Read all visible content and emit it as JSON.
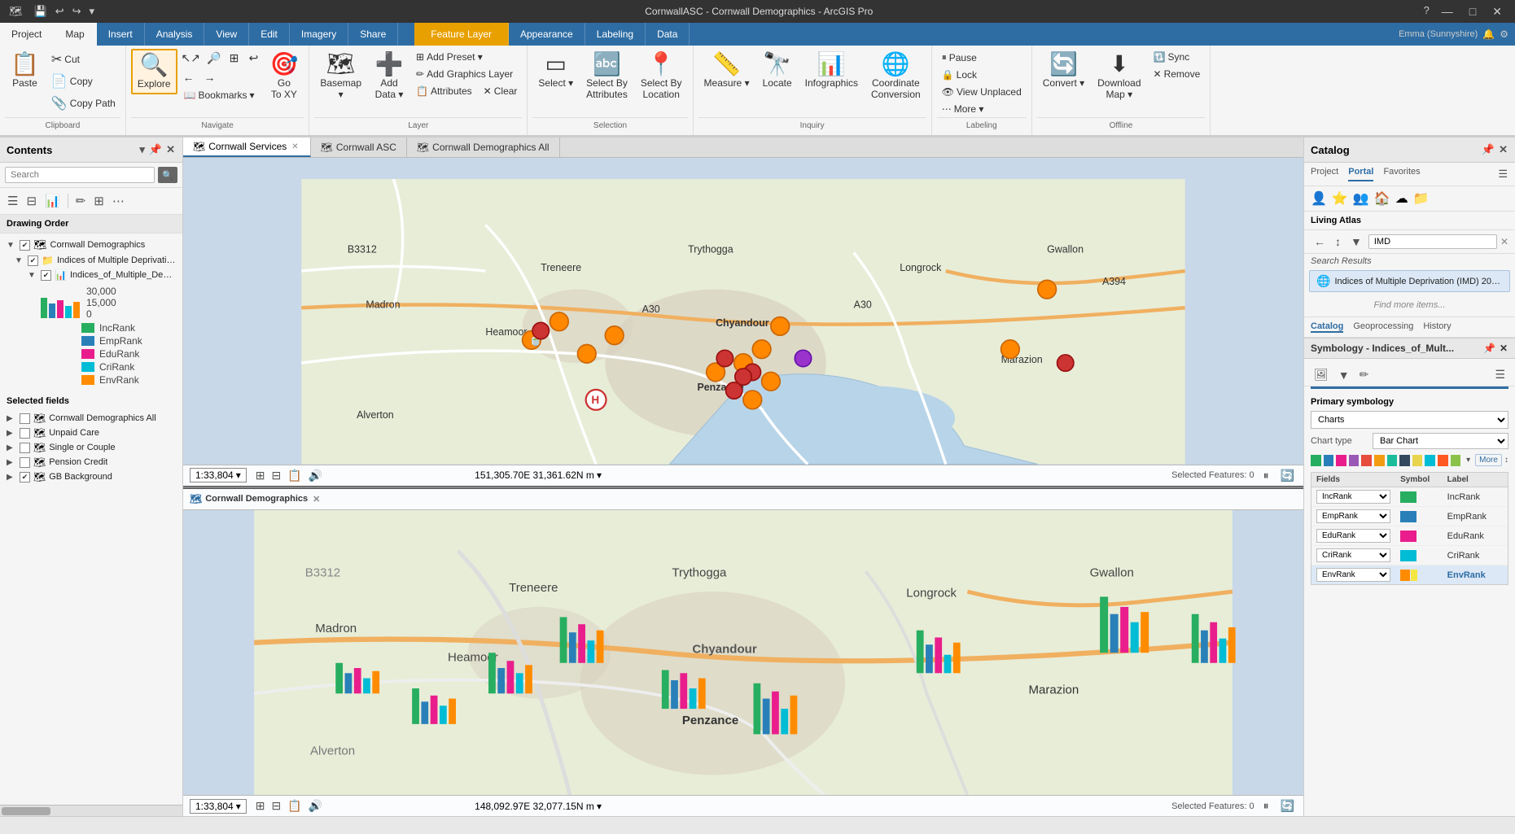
{
  "titlebar": {
    "title": "CornwallASC - Cornwall Demographics - ArcGIS Pro",
    "quicksave": "💾",
    "undo": "↩",
    "redo": "↪",
    "minimize": "—",
    "maximize": "□",
    "close": "✕",
    "help": "?"
  },
  "ribbon": {
    "tabs": [
      {
        "id": "project",
        "label": "Project",
        "active": false
      },
      {
        "id": "map",
        "label": "Map",
        "active": true
      },
      {
        "id": "insert",
        "label": "Insert",
        "active": false
      },
      {
        "id": "analysis",
        "label": "Analysis",
        "active": false
      },
      {
        "id": "view",
        "label": "View",
        "active": false
      },
      {
        "id": "edit",
        "label": "Edit",
        "active": false
      },
      {
        "id": "imagery",
        "label": "Imagery",
        "active": false
      },
      {
        "id": "share",
        "label": "Share",
        "active": false
      },
      {
        "id": "appearance",
        "label": "Appearance",
        "active": false
      },
      {
        "id": "labeling",
        "label": "Labeling",
        "active": false
      },
      {
        "id": "data",
        "label": "Data",
        "active": false
      }
    ],
    "feature_layer_tab": "Feature Layer",
    "groups": {
      "clipboard": {
        "label": "Clipboard",
        "buttons": [
          "Paste",
          "Cut",
          "Copy",
          "Copy Path"
        ]
      },
      "navigate": {
        "label": "Navigate",
        "explore": "Explore",
        "bookmarks": "Bookmarks",
        "goto_xy": "Go To XY"
      },
      "layer": {
        "label": "Layer",
        "basemap": "Basemap",
        "add_data": "Add Data",
        "add_preset": "Add Preset",
        "add_graphics": "Add Graphics Layer",
        "attributes": "Attributes",
        "clear": "Clear"
      },
      "selection": {
        "label": "Selection",
        "select": "Select",
        "select_by_attributes": "Select By Attributes",
        "select_by_location": "Select By Location"
      },
      "inquiry": {
        "label": "Inquiry",
        "measure": "Measure",
        "locate": "Locate",
        "infographics": "Infographics",
        "coordinate_conversion": "Coordinate Conversion"
      },
      "labeling": {
        "label": "Labeling",
        "pause": "Pause",
        "lock": "Lock",
        "view_unplaced": "View Unplaced",
        "more": "More"
      },
      "offline": {
        "label": "Offline",
        "convert": "Convert",
        "download_map": "Download Map",
        "sync": "Sync",
        "remove": "Remove"
      }
    }
  },
  "contents": {
    "title": "Contents",
    "search_placeholder": "Search",
    "drawing_order": "Drawing Order",
    "layers": [
      {
        "id": "cornwall-demographics",
        "name": "Cornwall Demographics",
        "level": 0,
        "checked": true,
        "expanded": true
      },
      {
        "id": "imd",
        "name": "Indices of Multiple Deprivation (I...",
        "level": 1,
        "checked": true,
        "expanded": true
      },
      {
        "id": "imd-sub",
        "name": "Indices_of_Multiple_Deprivation...",
        "level": 2,
        "checked": true,
        "expanded": true
      }
    ],
    "legend": [
      {
        "color": "#27ae60",
        "label": "IncRank"
      },
      {
        "color": "#2980b9",
        "label": "EmpRank"
      },
      {
        "color": "#e91e8c",
        "label": "EduRank"
      },
      {
        "color": "#00bcd4",
        "label": "CriRank"
      },
      {
        "color": "#ff8c00",
        "label": "EnvRank"
      }
    ],
    "scale_values": [
      "30,000",
      "15,000",
      "0"
    ],
    "selected_fields": "Selected fields",
    "other_layers": [
      {
        "name": "Cornwall Demographics All",
        "checked": false
      },
      {
        "name": "Unpaid Care",
        "checked": false
      },
      {
        "name": "Single or Couple",
        "checked": false
      },
      {
        "name": "Pension Credit",
        "checked": false
      },
      {
        "name": "GB Background",
        "checked": true
      }
    ]
  },
  "map_views": {
    "tabs": [
      {
        "id": "cornwall-services",
        "label": "Cornwall Services",
        "active": true,
        "closeable": true
      },
      {
        "id": "cornwall-asc",
        "label": "Cornwall ASC",
        "active": false,
        "closeable": false
      },
      {
        "id": "cornwall-demographics-all",
        "label": "Cornwall Demographics All",
        "active": false,
        "closeable": false
      }
    ],
    "top_map": {
      "title": "",
      "scale": "1:33,804",
      "coords": "151,305.70E 31,361.62N m",
      "selected_features": "Selected Features: 0",
      "map_labels": [
        "Madron",
        "Treneere",
        "Trythogga",
        "Heamoor",
        "Chyandour",
        "Longrock",
        "Gwallon",
        "Penzance",
        "Marazion"
      ],
      "road_labels": [
        "B3312",
        "A30",
        "A30",
        "A394"
      ]
    },
    "bottom_map": {
      "title": "Cornwall Demographics",
      "closeable": true,
      "scale": "1:33,804",
      "coords": "148,092.97E 32,077.15N m",
      "selected_features": "Selected Features: 0"
    }
  },
  "catalog": {
    "title": "Catalog",
    "tabs": [
      "Project",
      "Portal",
      "Favorites"
    ],
    "icons": [
      "👤",
      "⭐",
      "👥",
      "🏠",
      "🗃",
      "📁"
    ],
    "living_atlas": "Living Atlas",
    "search_value": "IMD",
    "search_results_label": "Search Results",
    "result_text": "Indices of Multiple Deprivation (IMD) 201...",
    "find_more": "Find more items...",
    "footer_tabs": [
      "Catalog",
      "Geoprocessing",
      "History"
    ]
  },
  "symbology": {
    "title": "Symbology - Indices_of_Mult...",
    "primary_label": "Primary symbology",
    "type_label": "Charts",
    "chart_type_label": "Chart type",
    "chart_type_value": "Bar Chart",
    "table_headers": [
      "Fields",
      "Symbol",
      "Label"
    ],
    "fields": [
      {
        "field": "IncRank",
        "color": "#27ae60",
        "label": "IncRank"
      },
      {
        "field": "EmpRank",
        "color": "#2980b9",
        "label": "EmpRank"
      },
      {
        "field": "EduRank",
        "color": "#e91e8c",
        "label": "EduRank"
      },
      {
        "field": "CriRank",
        "color": "#00bcd4",
        "label": "CriRank"
      },
      {
        "field": "EnvRank",
        "color": "#ff8c00",
        "label": "EnvRank"
      }
    ],
    "palette_colors": [
      "#27ae60",
      "#2980b9",
      "#e91e8c",
      "#9b59b6",
      "#e74c3c",
      "#f39c12",
      "#1abc9c",
      "#34495e",
      "#e8d44d",
      "#00bcd4",
      "#ff5722",
      "#8bc34a"
    ],
    "more_label": "More"
  },
  "statusbar": {
    "text": ""
  }
}
